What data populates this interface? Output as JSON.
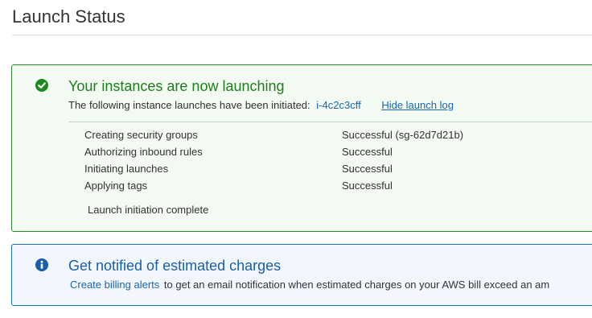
{
  "page": {
    "title": "Launch Status"
  },
  "success_panel": {
    "icon": "check-circle-icon",
    "title": "Your instances are now launching",
    "subtitle": "The following instance launches have been initiated:",
    "instance_id": "i-4c2c3cff",
    "hide_log_label": "Hide launch log",
    "log": [
      {
        "step": "Creating security groups",
        "result": "Successful (sg-62d7d21b)"
      },
      {
        "step": "Authorizing inbound rules",
        "result": "Successful"
      },
      {
        "step": "Initiating launches",
        "result": "Successful"
      },
      {
        "step": "Applying tags",
        "result": "Successful"
      }
    ],
    "complete_text": "Launch initiation complete",
    "color": "#1e7e1e"
  },
  "info_panel": {
    "icon": "info-circle-icon",
    "title": "Get notified of estimated charges",
    "link_label": "Create billing alerts",
    "text": "to get an email notification when estimated charges on your AWS bill exceed an am",
    "color": "#1a5fa8"
  }
}
